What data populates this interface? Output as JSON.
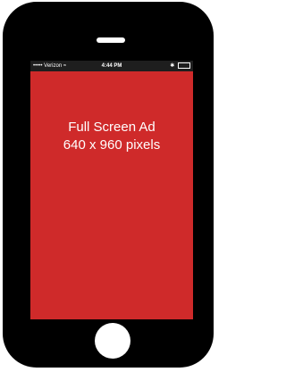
{
  "status_bar": {
    "carrier": "••••• Verizon",
    "wifi_icon": "wifi-icon",
    "time": "4:44 PM",
    "bluetooth_icon": "bluetooth-icon",
    "battery_icon": "battery-icon"
  },
  "ad": {
    "line1": "Full Screen Ad",
    "line2": "640 x 960 pixels",
    "background_color": "#cf2a2a"
  },
  "device": {
    "body_color": "#000000"
  }
}
